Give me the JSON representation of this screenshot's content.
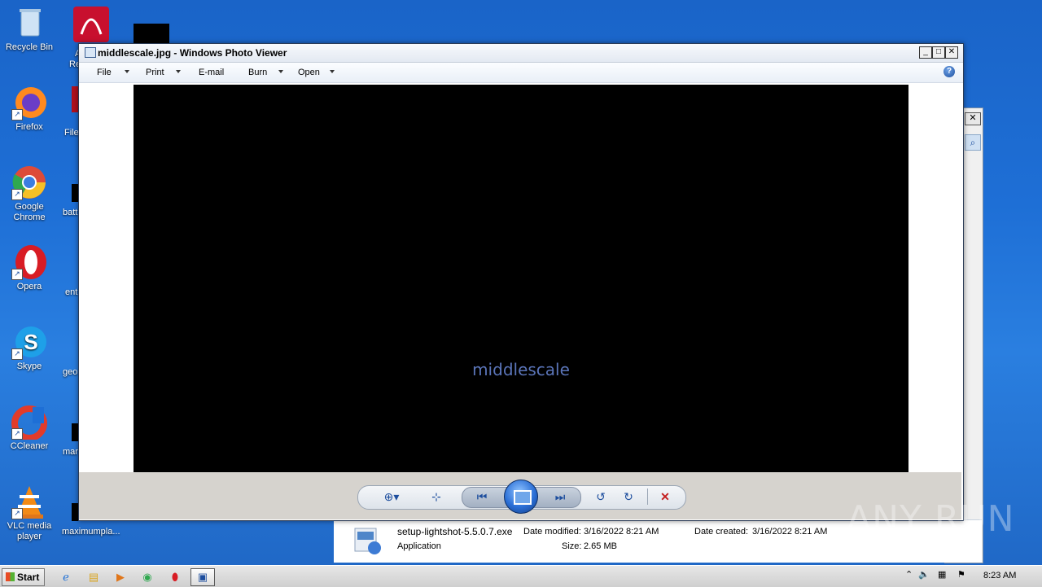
{
  "desktop": {
    "icons": [
      {
        "label": "Recycle Bin"
      },
      {
        "label": "Firefox"
      },
      {
        "label": "Google Chrome"
      },
      {
        "label": "Opera"
      },
      {
        "label": "Skype"
      },
      {
        "label": "CCleaner"
      },
      {
        "label": "VLC media player"
      }
    ],
    "column2": [
      "A",
      "Re",
      "File",
      "batt",
      "ent",
      "geo",
      "mar",
      "maximumpla..."
    ]
  },
  "photo_viewer": {
    "title": "middlescale.jpg - Windows Photo Viewer",
    "menu": [
      "File",
      "Print",
      "E-mail",
      "Burn",
      "Open"
    ],
    "help": "?",
    "image_caption": "middlescale"
  },
  "details": {
    "file_name": "setup-lightshot-5.5.0.7.exe",
    "file_type": "Application",
    "date_modified_label": "Date modified:",
    "date_modified": "3/16/2022 8:21 AM",
    "size_label": "Size:",
    "size": "2.65 MB",
    "date_created_label": "Date created:",
    "date_created": "3/16/2022 8:21 AM"
  },
  "taskbar": {
    "start": "Start",
    "clock": "8:23 AM"
  },
  "watermark": "ANY RUN"
}
